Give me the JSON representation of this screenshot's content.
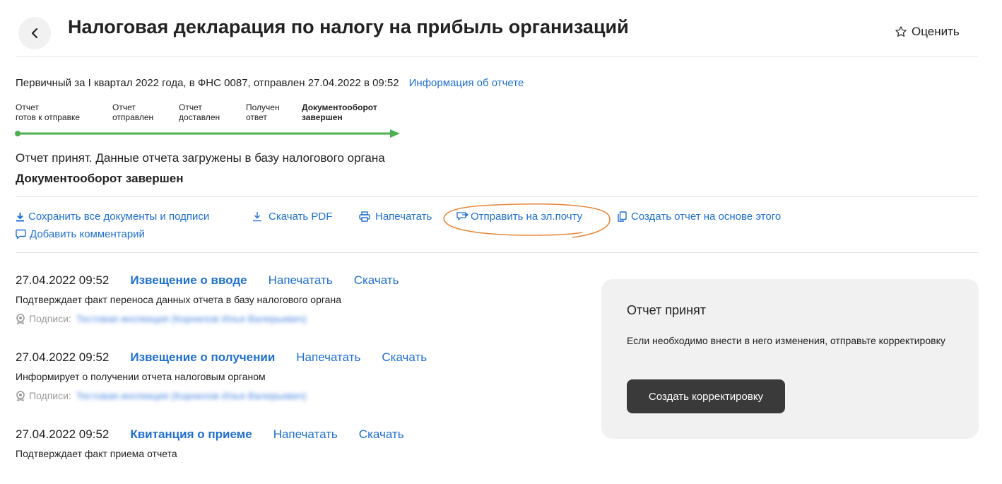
{
  "header": {
    "title": "Налоговая декларация по налогу на прибыль организаций",
    "rate_label": "Оценить"
  },
  "report": {
    "info": "Первичный за I квартал 2022 года, в ФНС 0087, отправлен 27.04.2022 в 09:52",
    "info_link": "Информация об отчете",
    "steps": [
      {
        "line1": "Отчет",
        "line2": "готов к отправке"
      },
      {
        "line1": "Отчет",
        "line2": "отправлен"
      },
      {
        "line1": "Отчет",
        "line2": "доставлен"
      },
      {
        "line1": "Получен",
        "line2": "ответ"
      },
      {
        "line1": "Документооборот",
        "line2": "завершен"
      }
    ],
    "status_text": "Отчет принят. Данные отчета загружены в базу налогового органа",
    "status_bold": "Документооборот завершен"
  },
  "actions": {
    "save_all": "Сохранить все документы и подписи",
    "download_pdf": "Скачать PDF",
    "print": "Напечатать",
    "send_email": "Отправить на эл.почту",
    "create_based": "Создать отчет на основе этого",
    "add_comment": "Добавить комментарий"
  },
  "events": [
    {
      "datetime": "27.04.2022 09:52",
      "title": "Извещение о вводе",
      "print": "Напечатать",
      "download": "Скачать",
      "description": "Подтверждает факт переноса данных отчета в базу налогового органа",
      "signatures_label": "Подписи:",
      "signatures_value": "Тестовая инспекция (Корнилов Илья Валерьевич)"
    },
    {
      "datetime": "27.04.2022 09:52",
      "title": "Извещение о получении",
      "print": "Напечатать",
      "download": "Скачать",
      "description": "Информирует о получении отчета налоговым органом",
      "signatures_label": "Подписи:",
      "signatures_value": "Тестовая инспекция (Корнилов Илья Валерьевич)"
    },
    {
      "datetime": "27.04.2022 09:52",
      "title": "Квитанция о приеме",
      "print": "Напечатать",
      "download": "Скачать",
      "description": "Подтверждает факт приема отчета"
    }
  ],
  "side_card": {
    "title": "Отчет принят",
    "text": "Если необходимо внести в него изменения, отправьте корректировку",
    "button": "Создать корректировку"
  },
  "colors": {
    "link": "#1f6fd1",
    "progress": "#4caf50",
    "highlight_annotation": "#e8863a",
    "card_bg": "#f1f1f1",
    "button_bg": "#3a3a3a"
  },
  "icons": [
    "chevron-left-icon",
    "star-outline-icon",
    "download-icon",
    "download-outline-icon",
    "printer-icon",
    "email-send-icon",
    "copy-icon",
    "comment-icon",
    "signature-badge-icon"
  ]
}
